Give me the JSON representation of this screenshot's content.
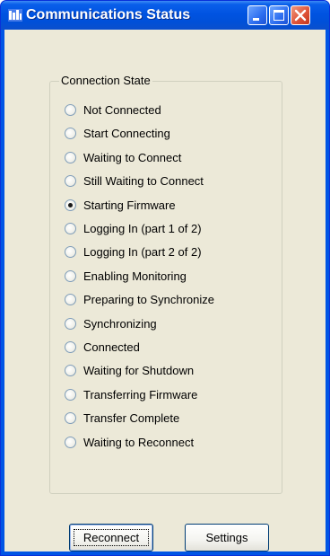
{
  "window": {
    "title": "Communications Status"
  },
  "connection_state": {
    "caption": "Connection State",
    "selected_index": 4,
    "options": [
      "Not Connected",
      "Start Connecting",
      "Waiting to Connect",
      "Still Waiting to Connect",
      "Starting Firmware",
      "Logging In (part 1 of 2)",
      "Logging In (part 2 of 2)",
      "Enabling Monitoring",
      "Preparing to Synchronize",
      "Synchronizing",
      "Connected",
      "Waiting for Shutdown",
      "Transferring Firmware",
      "Transfer Complete",
      "Waiting to Reconnect"
    ]
  },
  "buttons": {
    "reconnect": "Reconnect",
    "settings": "Settings"
  }
}
